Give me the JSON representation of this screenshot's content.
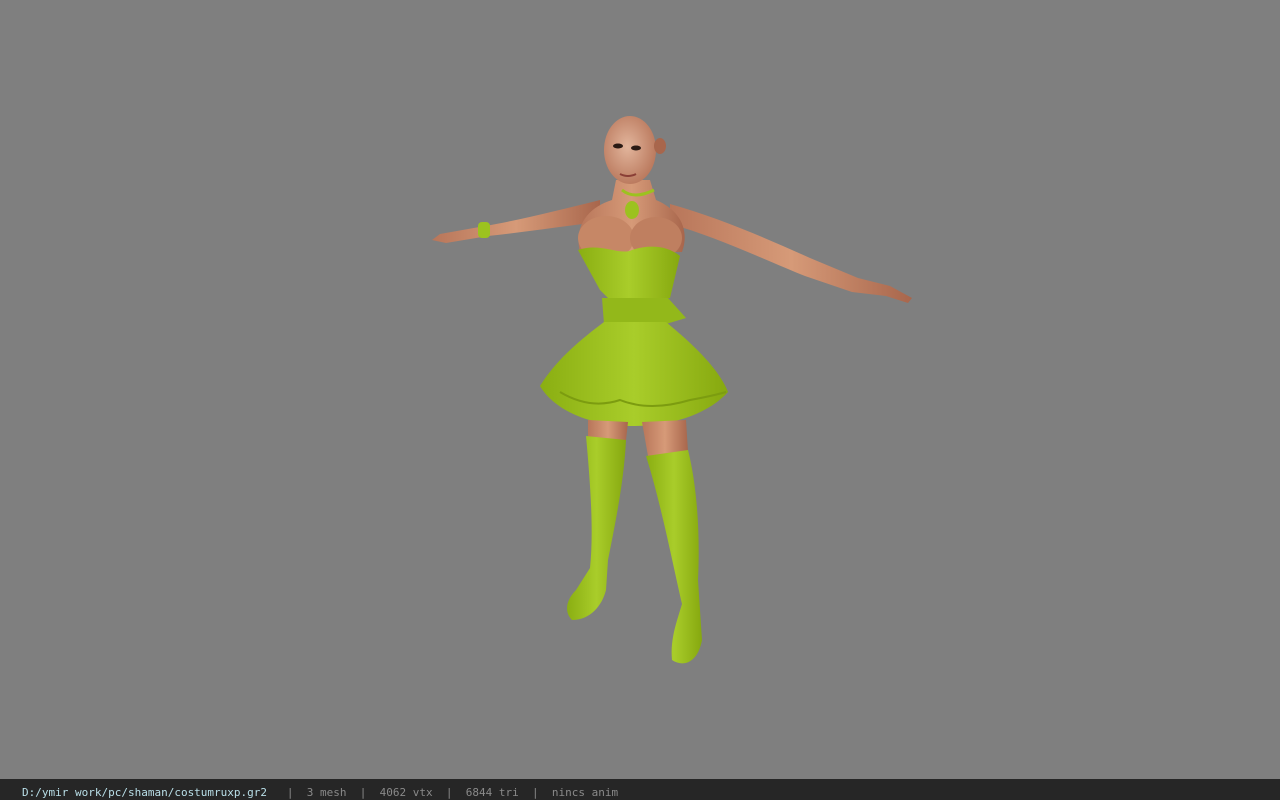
{
  "viewport": {
    "background_color": "#7f7f7f",
    "model": {
      "description_icon": "character-model-icon",
      "skin_color": "#c98a66",
      "outfit_color": "#9cc21f"
    }
  },
  "status_bar": {
    "file_path": "D:/ymir work/pc/shaman/costumruxp.gr2",
    "separator": "|",
    "mesh": "3 mesh",
    "vertices": "4062 vtx",
    "triangles": "6844 tri",
    "animation": "nincs anim"
  }
}
